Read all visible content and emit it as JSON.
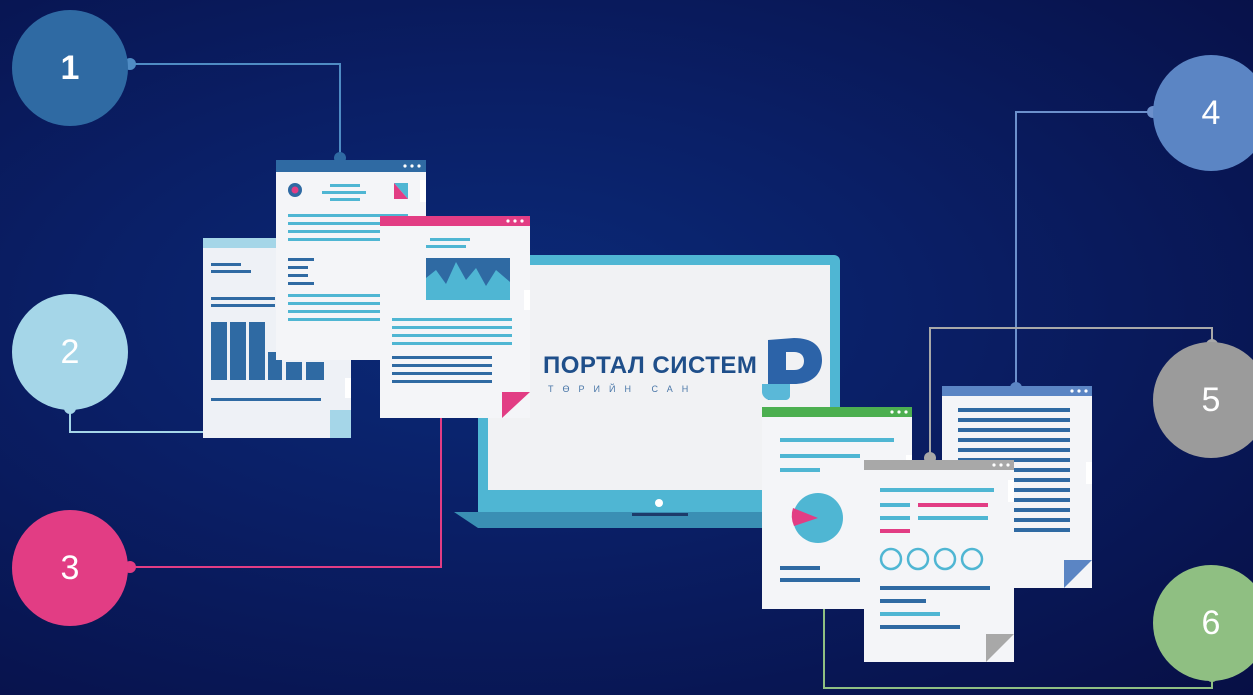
{
  "markers": {
    "m1": "1",
    "m2": "2",
    "m3": "3",
    "m4": "4",
    "m5": "5",
    "m6": "6"
  },
  "logo": {
    "title": "ПОРТАЛ СИСТЕМ",
    "subtitle": "ТӨРИЙН САН"
  },
  "colors": {
    "background": "#0a1f66",
    "marker_1": "#2f6aa3",
    "marker_2": "#a5d6e8",
    "marker_3": "#e23d84",
    "marker_4": "#5b85c4",
    "marker_5": "#9b9b9b",
    "marker_6": "#8fbf82",
    "laptop_frame": "#4fb6d3"
  }
}
